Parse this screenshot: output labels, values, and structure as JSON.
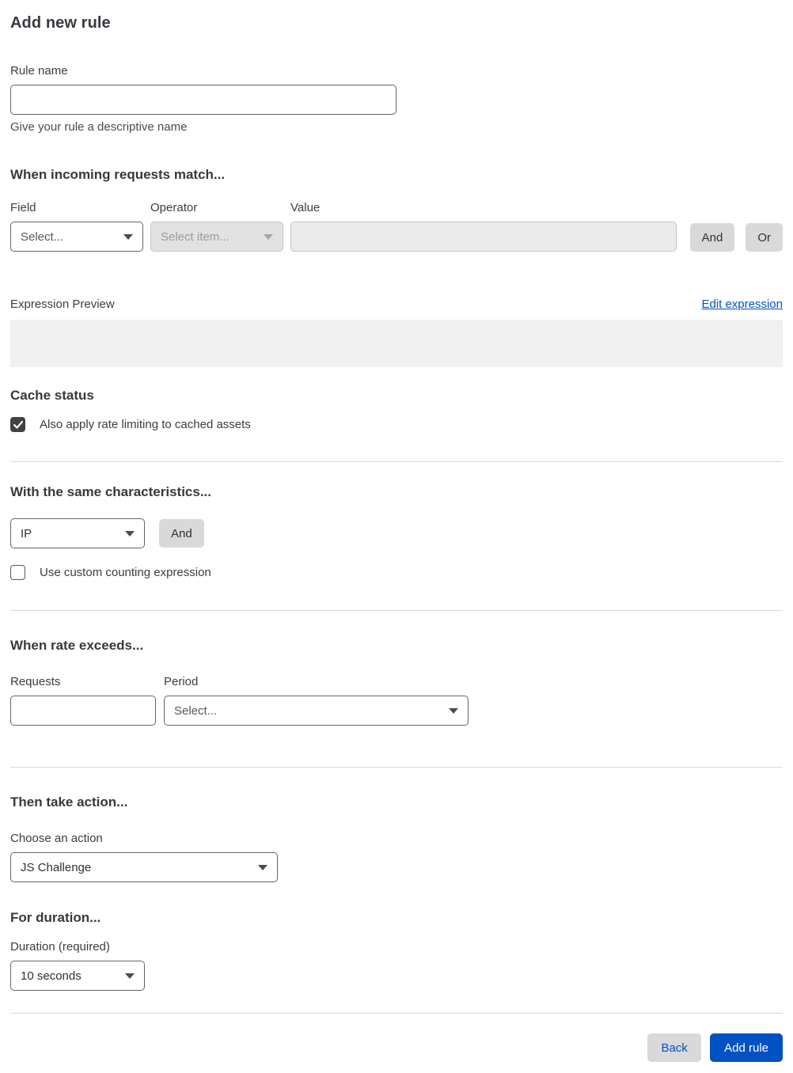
{
  "page": {
    "title": "Add new rule"
  },
  "rule_name": {
    "label": "Rule name",
    "value": "",
    "helper": "Give your rule a descriptive name"
  },
  "match": {
    "heading": "When incoming requests match...",
    "field": {
      "label": "Field",
      "selected": "Select..."
    },
    "operator": {
      "label": "Operator",
      "selected": "Select item..."
    },
    "value": {
      "label": "Value",
      "value": "",
      "placeholder": ""
    },
    "and_label": "And",
    "or_label": "Or"
  },
  "expression": {
    "label": "Expression Preview",
    "edit_link": "Edit expression",
    "preview_value": ""
  },
  "cache": {
    "heading": "Cache status",
    "checkbox_label": "Also apply rate limiting to cached assets",
    "checked": true
  },
  "characteristics": {
    "heading": "With the same characteristics...",
    "selected": "IP",
    "and_label": "And",
    "checkbox_label": "Use custom counting expression",
    "checked": false
  },
  "rate": {
    "heading": "When rate exceeds...",
    "requests": {
      "label": "Requests",
      "value": ""
    },
    "period": {
      "label": "Period",
      "selected": "Select..."
    }
  },
  "action": {
    "heading": "Then take action...",
    "label": "Choose an action",
    "selected": "JS Challenge"
  },
  "duration": {
    "heading": "For duration...",
    "label": "Duration (required)",
    "selected": "10 seconds"
  },
  "footer": {
    "back_label": "Back",
    "submit_label": "Add rule"
  },
  "colors": {
    "accent_blue": "#0051c3",
    "checkbox_checked": "#424242",
    "button_gray": "#d9d9d9",
    "disabled_bg": "#ebebeb"
  },
  "icons": {
    "chevron_down": "caret-down",
    "checkmark": "check"
  }
}
